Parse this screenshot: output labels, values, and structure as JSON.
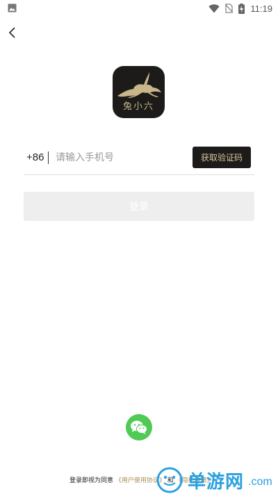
{
  "status_bar": {
    "time": "11:19"
  },
  "app": {
    "logo_text": "兔小六"
  },
  "login_form": {
    "country_code": "+86",
    "phone_placeholder": "请输入手机号",
    "get_code_label": "获取验证码",
    "login_label": "登录"
  },
  "agreement": {
    "prefix": "登录即视为同意",
    "user_agreement": "《用户使用协议》",
    "conjunction": "和",
    "privacy_policy": "《隐私政策》"
  },
  "watermark": {
    "text": "单游网",
    "domain": ".com"
  },
  "colors": {
    "gold": "#d7c49a",
    "dark_button": "#1c1b1a",
    "wechat_green": "#4fca54",
    "login_disabled": "#eeeeee"
  }
}
